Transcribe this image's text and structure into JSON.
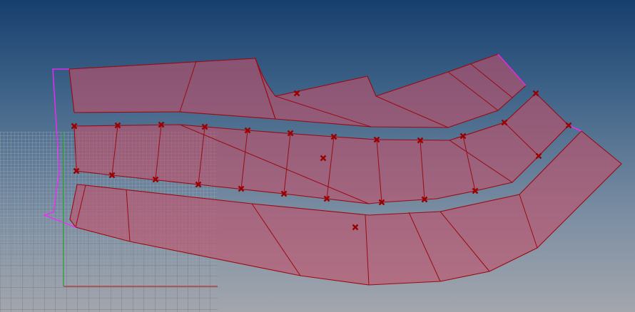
{
  "viewport": {
    "colors": {
      "background_top": "#173f6e",
      "background_bottom": "#a3a6ad",
      "surface_fill": "#c0506a",
      "surface_edge": "#9a0a12",
      "marker": "#9a0000",
      "selection_outline": "#ff22ff",
      "axis_y": "#3aa040",
      "axis_x": "#b04040",
      "grid": "#c8d0d8"
    },
    "icons": [
      "node-marker-icon"
    ]
  }
}
